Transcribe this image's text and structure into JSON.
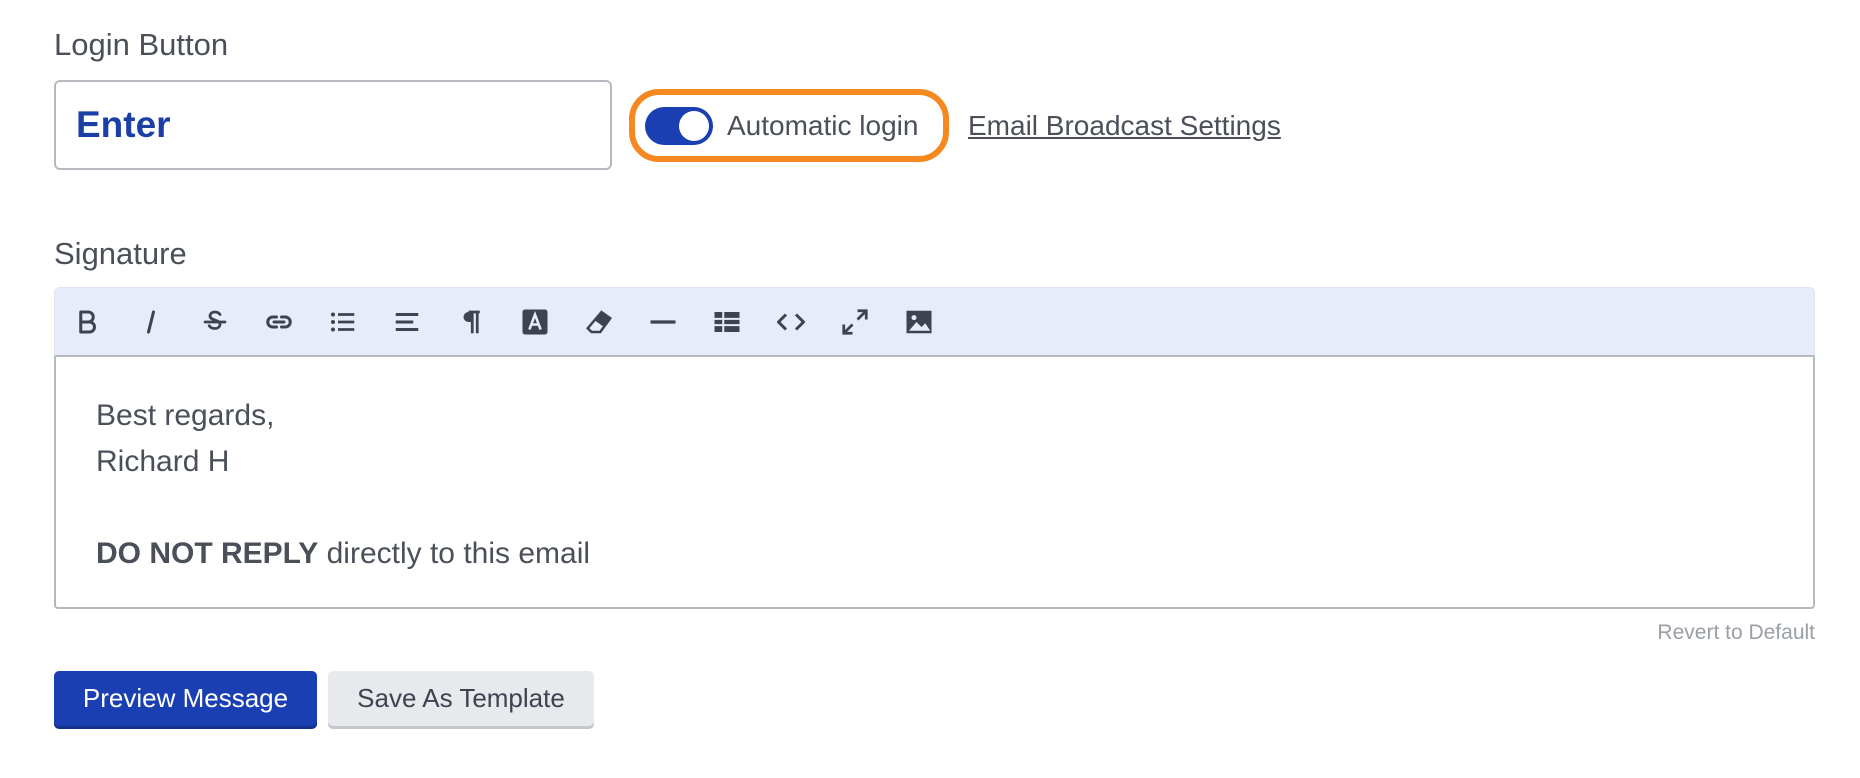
{
  "login_section": {
    "label": "Login Button",
    "button_text_value": "Enter",
    "auto_login": {
      "label": "Automatic login",
      "enabled": true
    },
    "broadcast_link": "Email Broadcast Settings"
  },
  "signature_section": {
    "label": "Signature",
    "toolbar": [
      {
        "name": "bold-icon",
        "title": "Bold"
      },
      {
        "name": "italic-icon",
        "title": "Italic"
      },
      {
        "name": "strikethrough-icon",
        "title": "Strikethrough"
      },
      {
        "name": "link-icon",
        "title": "Link"
      },
      {
        "name": "bullet-list-icon",
        "title": "Bulleted list"
      },
      {
        "name": "align-icon",
        "title": "Align"
      },
      {
        "name": "paragraph-icon",
        "title": "Paragraph"
      },
      {
        "name": "text-color-icon",
        "title": "Text color"
      },
      {
        "name": "eraser-icon",
        "title": "Clear formatting"
      },
      {
        "name": "horizontal-rule-icon",
        "title": "Horizontal rule"
      },
      {
        "name": "table-icon",
        "title": "Table"
      },
      {
        "name": "code-icon",
        "title": "Code view"
      },
      {
        "name": "fullscreen-icon",
        "title": "Fullscreen"
      },
      {
        "name": "image-icon",
        "title": "Image"
      }
    ],
    "content": {
      "line1": "Best regards,",
      "line2": "Richard H",
      "warning_bold": "DO NOT REPLY",
      "warning_rest": " directly to this email"
    },
    "revert_label": "Revert to Default"
  },
  "actions": {
    "preview_label": "Preview Message",
    "save_template_label": "Save As Template"
  },
  "colors": {
    "accent": "#1a3fb3",
    "highlight": "#f5881f",
    "toolbar_bg": "#e8ebf8"
  }
}
